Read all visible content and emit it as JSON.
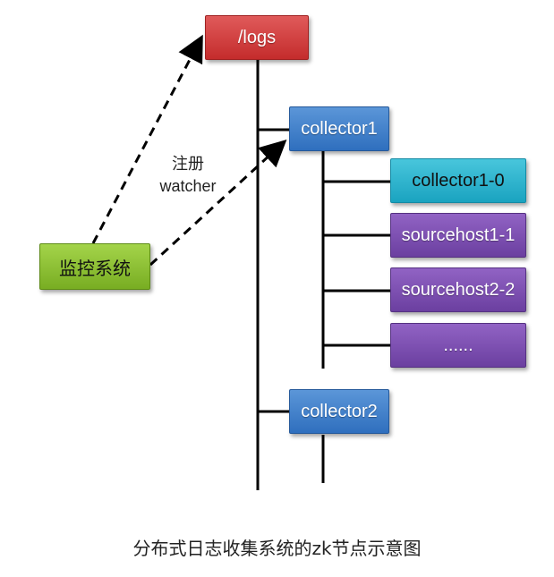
{
  "nodes": {
    "logs": "/logs",
    "collector1": "collector1",
    "collector1_0": "collector1-0",
    "sourcehost1_1": "sourcehost1-1",
    "sourcehost2_2": "sourcehost2-2",
    "ellipsis": "......",
    "collector2": "collector2",
    "monitor": "监控系统"
  },
  "edge_label": {
    "line1": "注册",
    "line2": "watcher"
  },
  "caption": "分布式日志收集系统的zk节点示意图",
  "colors": {
    "root": "#c42c2c",
    "collector": "#2f6fbe",
    "collector_child": "#1aa3c0",
    "source_host": "#6b3fa0",
    "monitor": "#78ad22",
    "line": "#000000"
  }
}
